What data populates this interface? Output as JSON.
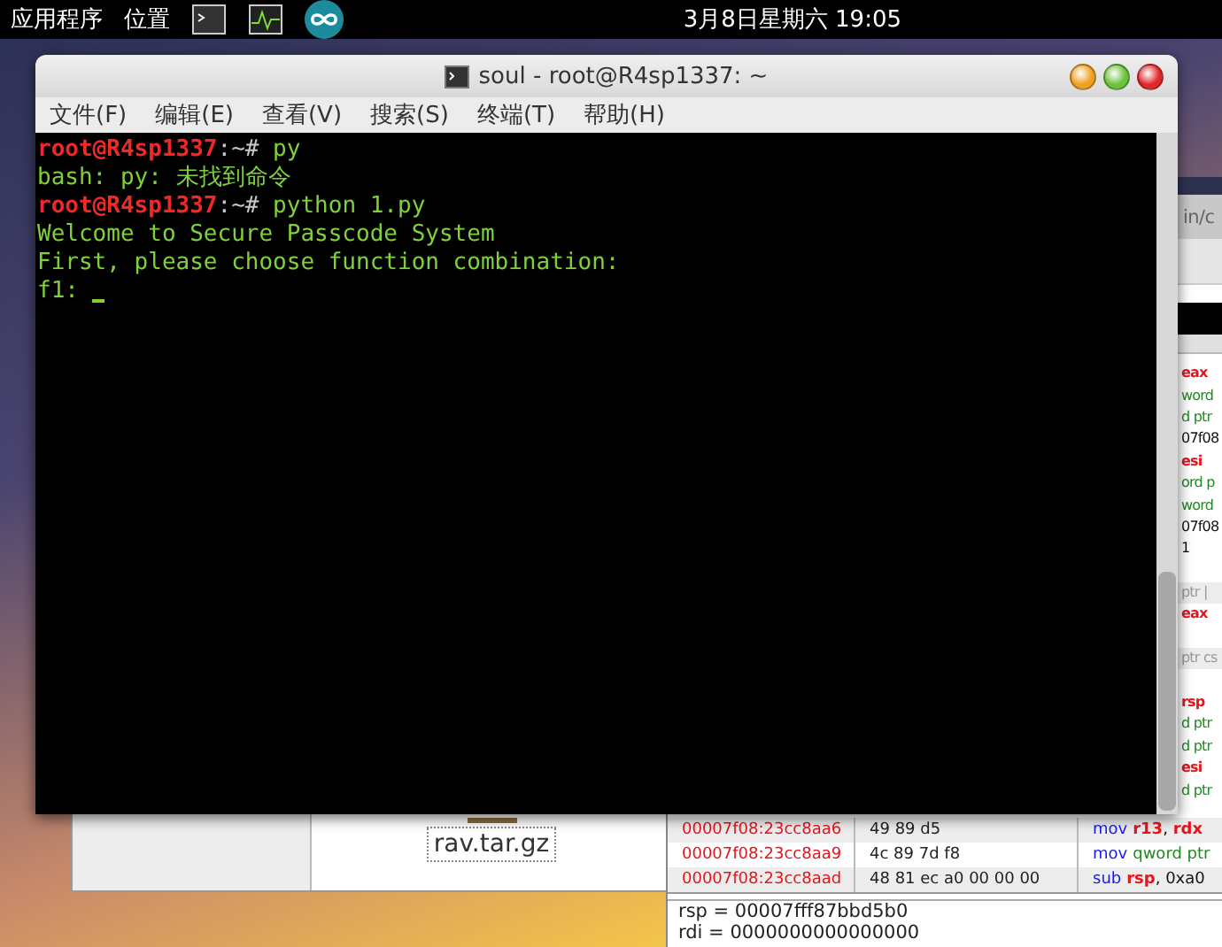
{
  "top_panel": {
    "menus": [
      "应用程序",
      "位置"
    ],
    "launchers": [
      {
        "kind": "terminal"
      },
      {
        "kind": "monitor"
      },
      {
        "kind": "arduino"
      }
    ],
    "clock": "3月8日星期六 19:05"
  },
  "file_manager": {
    "files": [
      {
        "name": "rav.tar.gz",
        "selected": true
      }
    ]
  },
  "debugger": {
    "path": "in/c",
    "fragments": [
      {
        "kind": "reg",
        "text": "eax"
      },
      {
        "kind": "mem",
        "text": "word"
      },
      {
        "kind": "mem",
        "text": "d ptr"
      },
      {
        "kind": "plain",
        "text": "07f08"
      },
      {
        "kind": "reg",
        "text": "esi"
      },
      {
        "kind": "mem",
        "text": "ord p"
      },
      {
        "kind": "mem",
        "text": "word"
      },
      {
        "kind": "plain",
        "text": "07f08"
      },
      {
        "kind": "plain",
        "text": "1"
      },
      {
        "kind": "blank"
      },
      {
        "kind": "muted",
        "text": "ptr |"
      },
      {
        "kind": "reg",
        "text": "eax"
      },
      {
        "kind": "blank"
      },
      {
        "kind": "muted",
        "text": "ptr cs"
      },
      {
        "kind": "blank"
      },
      {
        "kind": "reg",
        "text": "rsp"
      },
      {
        "kind": "mem",
        "text": "d ptr"
      },
      {
        "kind": "mem",
        "text": "d ptr"
      },
      {
        "kind": "reg",
        "text": "esi"
      },
      {
        "kind": "mem",
        "text": "d ptr"
      }
    ],
    "disassembly": [
      {
        "address": "00007f08:23cc8aa6",
        "bytes": "49 89 d5",
        "mnemonic": "mov",
        "operands": [
          {
            "kind": "reg",
            "text": "r13"
          },
          {
            "kind": "plain",
            "text": ", "
          },
          {
            "kind": "reg",
            "text": "rdx"
          }
        ]
      },
      {
        "address": "00007f08:23cc8aa9",
        "bytes": "4c 89 7d f8",
        "mnemonic": "mov",
        "operands": [
          {
            "kind": "mem",
            "text": "qword ptr"
          }
        ]
      },
      {
        "address": "00007f08:23cc8aad",
        "bytes": "48 81 ec a0 00 00 00",
        "mnemonic": "sub",
        "operands": [
          {
            "kind": "reg",
            "text": "rsp"
          },
          {
            "kind": "plain",
            "text": ", 0xa0"
          }
        ]
      }
    ],
    "registers": [
      "rsp = 00007fff87bbd5b0",
      "rdi = 0000000000000000"
    ]
  },
  "terminal": {
    "title": "soul - root@R4sp1337: ~",
    "menu": [
      "文件(F)",
      "编辑(E)",
      "查看(V)",
      "搜索(S)",
      "终端(T)",
      "帮助(H)"
    ],
    "lines": [
      {
        "kind": "prompt",
        "user": "root@R4sp1337",
        "path": ":~#",
        "command": "py"
      },
      {
        "kind": "output",
        "text": "bash: py: 未找到命令"
      },
      {
        "kind": "prompt",
        "user": "root@R4sp1337",
        "path": ":~#",
        "command": "python 1.py"
      },
      {
        "kind": "output",
        "text": "Welcome to Secure Passcode System"
      },
      {
        "kind": "output",
        "text": "First, please choose function combination:"
      },
      {
        "kind": "input",
        "text": "f1:",
        "cursor": true
      }
    ]
  }
}
